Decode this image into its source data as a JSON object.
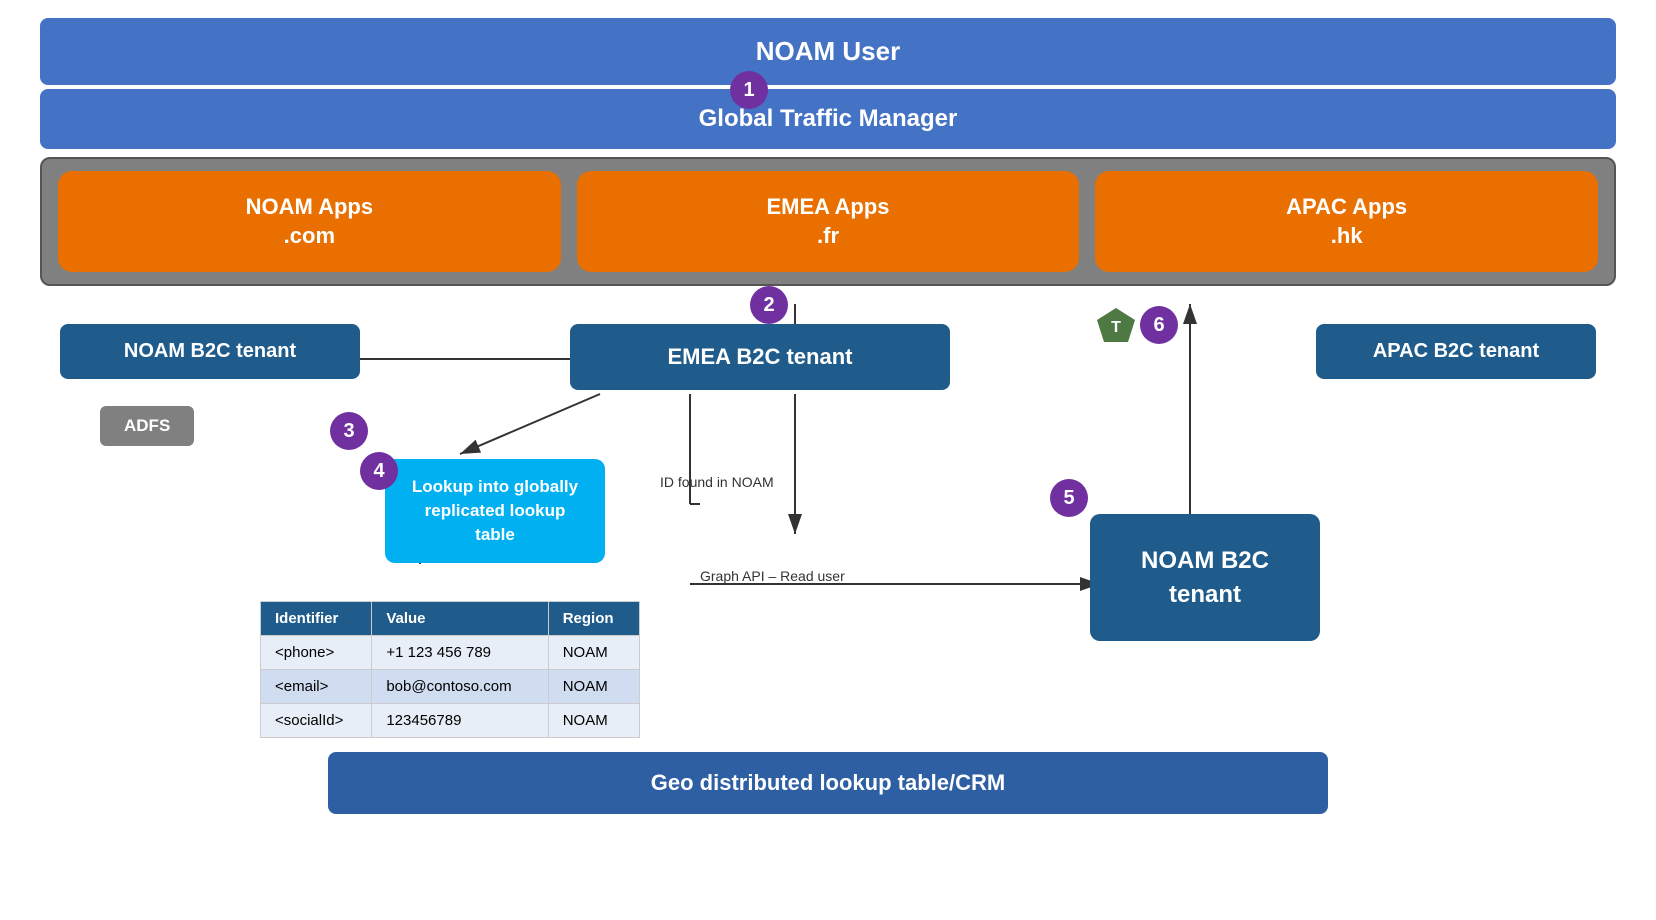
{
  "noam_user": {
    "label": "NOAM User"
  },
  "global_traffic_manager": {
    "label": "Global Traffic Manager",
    "badge": "1"
  },
  "apps": {
    "noam": {
      "line1": "NOAM Apps",
      "line2": ".com"
    },
    "emea": {
      "line1": "EMEA Apps",
      "line2": ".fr"
    },
    "apac": {
      "line1": "APAC Apps",
      "line2": ".hk"
    }
  },
  "badges": {
    "b2": "2",
    "b3": "3",
    "b4": "4",
    "b5": "5",
    "b6": "6"
  },
  "tenants": {
    "noam_b2c": "NOAM B2C tenant",
    "emea_b2c": "EMEA B2C tenant",
    "apac_b2c": "APAC B2C tenant",
    "noam_b2c_large_line1": "NOAM B2C",
    "noam_b2c_large_line2": "tenant"
  },
  "adfs": {
    "label": "ADFS"
  },
  "lookup_bubble": {
    "line1": "Lookup into globally",
    "line2": "replicated lookup table"
  },
  "table": {
    "headers": [
      "Identifier",
      "Value",
      "Region"
    ],
    "rows": [
      [
        "<phone>",
        "+1 123 456 789",
        "NOAM"
      ],
      [
        "<email>",
        "bob@contoso.com",
        "NOAM"
      ],
      [
        "<socialId>",
        "123456789",
        "NOAM"
      ]
    ]
  },
  "labels": {
    "id_found_noam": "ID found in NOAM",
    "graph_api": "Graph API – Read user"
  },
  "geo_bar": {
    "label": "Geo distributed lookup table/CRM"
  },
  "colors": {
    "blue_accent": "#4472C4",
    "purple": "#7030A0",
    "orange": "#E97000",
    "teal": "#00B0F0",
    "dark_blue": "#1F5C8B",
    "green_pentagon": "#4F7942"
  }
}
